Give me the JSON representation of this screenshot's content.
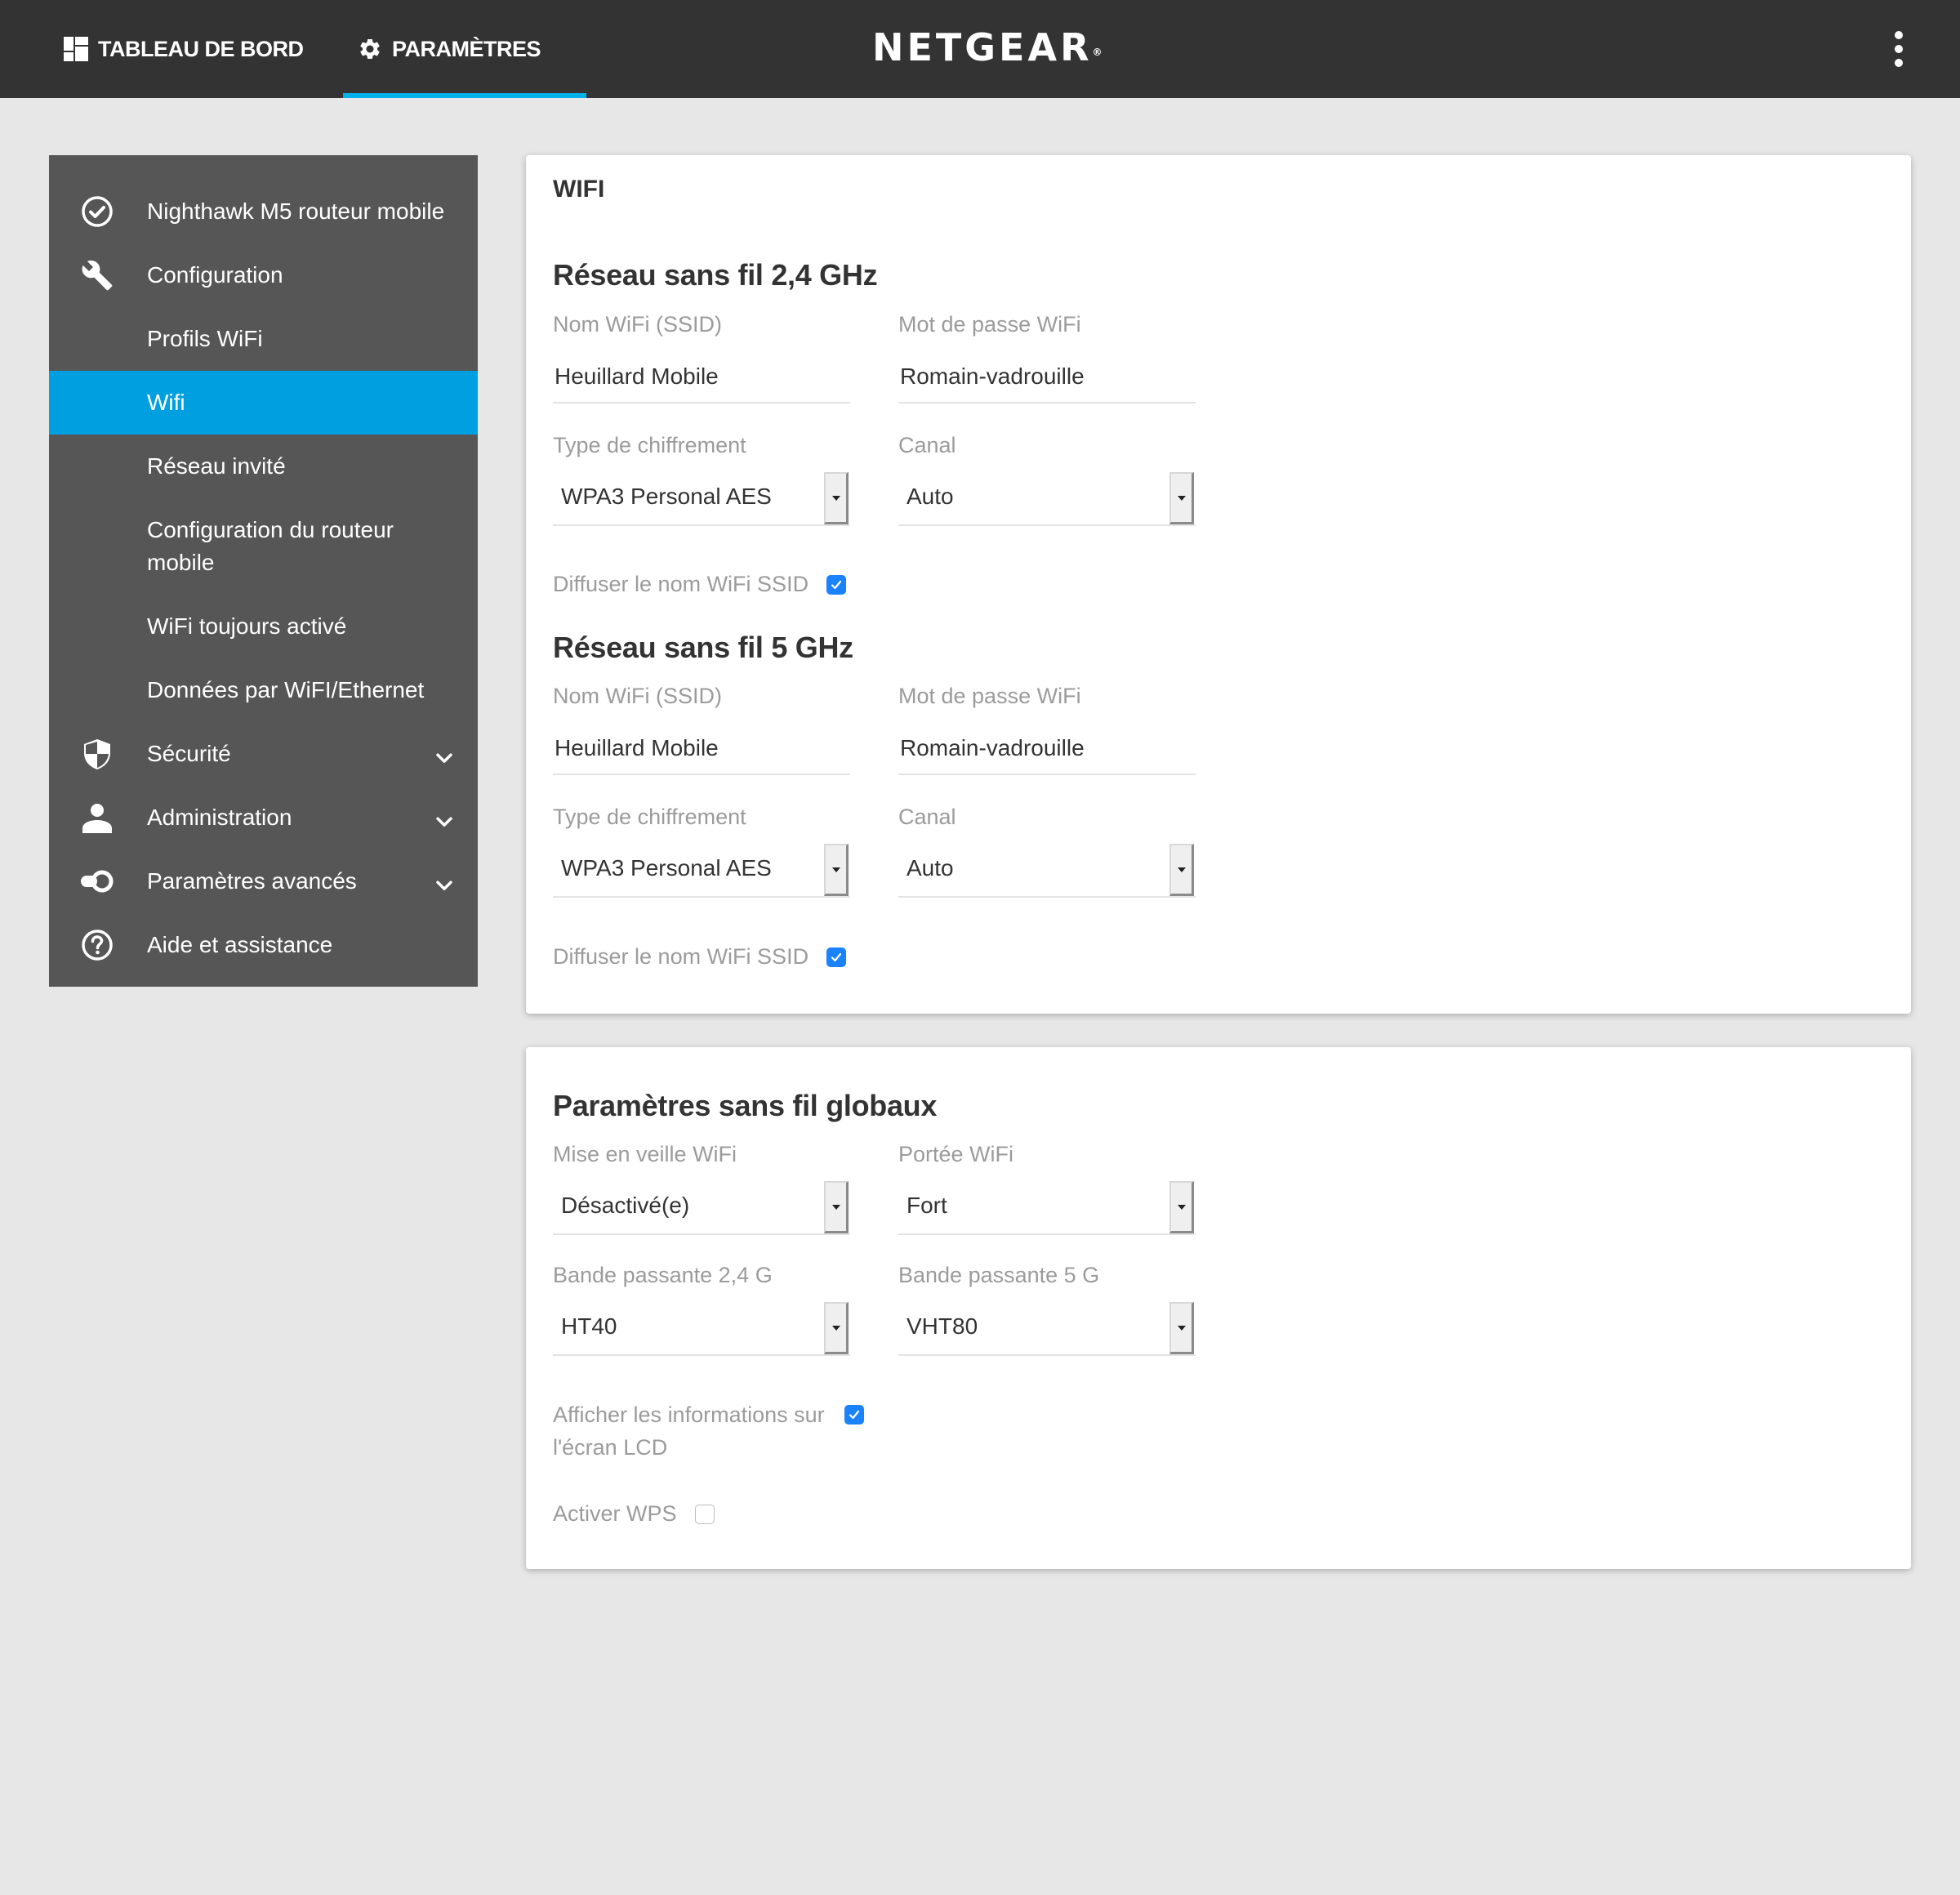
{
  "header": {
    "tabs": [
      {
        "label": "TABLEAU DE BORD",
        "icon": "dashboard-icon",
        "active": false
      },
      {
        "label": "PARAMÈTRES",
        "icon": "gear-icon",
        "active": true
      }
    ],
    "logo": "NETGEAR",
    "logo_mark": "®",
    "accent_color": "#00b1eb"
  },
  "sidebar": {
    "items": [
      {
        "label": "Nighthawk M5 routeur mobile",
        "icon": "check-circle-icon",
        "expandable": false
      },
      {
        "label": "Configuration",
        "icon": "wrench-icon",
        "expandable": false
      },
      {
        "label": "Profils WiFi",
        "icon": "",
        "expandable": false
      },
      {
        "label": "Wifi",
        "icon": "",
        "expandable": false,
        "active": true
      },
      {
        "label": "Réseau invité",
        "icon": "",
        "expandable": false
      },
      {
        "label": "Configuration du routeur mobile",
        "icon": "",
        "expandable": false
      },
      {
        "label": "WiFi toujours activé",
        "icon": "",
        "expandable": false
      },
      {
        "label": "Données par WiFI/Ethernet",
        "icon": "",
        "expandable": false
      },
      {
        "label": "Sécurité",
        "icon": "shield-icon",
        "expandable": true
      },
      {
        "label": "Administration",
        "icon": "person-icon",
        "expandable": true
      },
      {
        "label": "Paramètres avancés",
        "icon": "toggle-icon",
        "expandable": true
      },
      {
        "label": "Aide et assistance",
        "icon": "help-circle-icon",
        "expandable": false
      }
    ],
    "active_color": "#009fe0"
  },
  "wifi_card": {
    "title": "WIFI",
    "band_24": {
      "title": "Réseau sans fil 2,4 GHz",
      "ssid_label": "Nom WiFi (SSID)",
      "ssid_value": "Heuillard Mobile",
      "password_label": "Mot de passe WiFi",
      "password_value": "Romain-vadrouille",
      "encryption_label": "Type de chiffrement",
      "encryption_value": "WPA3 Personal AES",
      "channel_label": "Canal",
      "channel_value": "Auto",
      "broadcast_label": "Diffuser le nom WiFi SSID",
      "broadcast_checked": true
    },
    "band_5": {
      "title": "Réseau sans fil 5 GHz",
      "ssid_label": "Nom WiFi (SSID)",
      "ssid_value": "Heuillard Mobile",
      "password_label": "Mot de passe WiFi",
      "password_value": "Romain-vadrouille",
      "encryption_label": "Type de chiffrement",
      "encryption_value": "WPA3 Personal AES",
      "channel_label": "Canal",
      "channel_value": "Auto",
      "broadcast_label": "Diffuser le nom WiFi SSID",
      "broadcast_checked": true
    }
  },
  "global_card": {
    "title": "Paramètres sans fil globaux",
    "sleep_label": "Mise en veille WiFi",
    "sleep_value": "Désactivé(e)",
    "range_label": "Portée WiFi",
    "range_value": "Fort",
    "bw24_label": "Bande passante 2,4 G",
    "bw24_value": "HT40",
    "bw5_label": "Bande passante 5 G",
    "bw5_value": "VHT80",
    "lcd_label_line1": "Afficher les informations sur",
    "lcd_label_line2": "l'écran LCD",
    "lcd_checked": true,
    "wps_label": "Activer WPS",
    "wps_checked": false
  },
  "checkbox_color": "#1a82fb"
}
